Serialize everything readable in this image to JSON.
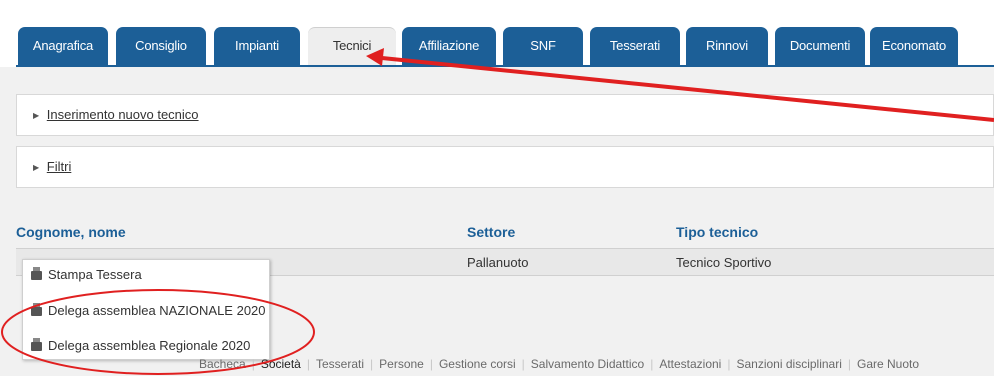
{
  "tabs": [
    {
      "label": "Anagrafica"
    },
    {
      "label": "Consiglio"
    },
    {
      "label": "Impianti"
    },
    {
      "label": "Tecnici",
      "active": true
    },
    {
      "label": "Affiliazione"
    },
    {
      "label": "SNF"
    },
    {
      "label": "Tesserati"
    },
    {
      "label": "Rinnovi"
    },
    {
      "label": "Documenti"
    },
    {
      "label": "Economato"
    }
  ],
  "panels": {
    "insert_label": "Inserimento nuovo tecnico",
    "filters_label": "Filtri"
  },
  "table": {
    "headers": [
      "Cognome, nome",
      "Settore",
      "Tipo tecnico"
    ],
    "row": {
      "name": "",
      "settore": "Pallanuoto",
      "tipo": "Tecnico Sportivo"
    }
  },
  "context_menu": {
    "items": [
      "Stampa Tessera",
      "Delega assemblea NAZIONALE 2020",
      "Delega assemblea Regionale 2020"
    ],
    "icon": "printer-icon"
  },
  "footer_nav": {
    "items": [
      "Bacheca",
      "Società",
      "Tesserati",
      "Persone",
      "Gestione corsi",
      "Salvamento Didattico",
      "Attestazioni",
      "Sanzioni disciplinari",
      "Gare Nuoto"
    ],
    "current": "Società"
  },
  "colors": {
    "tab": "#1c5f97",
    "annotation": "#e02020"
  }
}
